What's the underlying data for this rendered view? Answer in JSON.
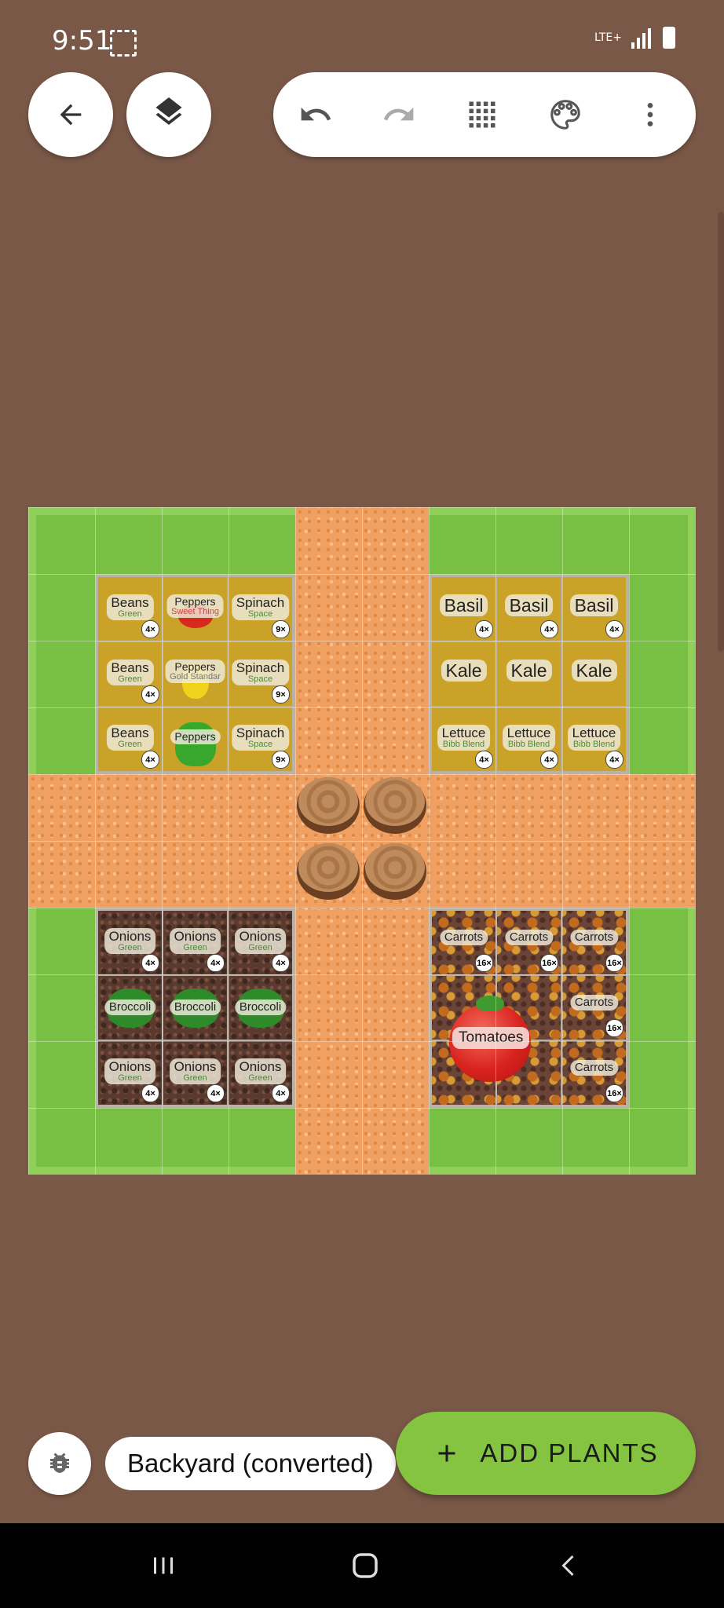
{
  "status_bar": {
    "time": "9:51",
    "network": "LTE+"
  },
  "toolbar": {
    "back_icon": "arrow-left-icon",
    "layers_icon": "layers-icon",
    "undo_icon": "undo-icon",
    "redo_icon": "redo-icon",
    "grid_icon": "grid-icon",
    "palette_icon": "palette-icon",
    "more_icon": "more-vert-icon"
  },
  "beds": {
    "top_left": [
      {
        "name": "Beans",
        "variety": "Green",
        "count": "4×"
      },
      {
        "name": "Peppers",
        "variety": "Sweet Thing",
        "count": ""
      },
      {
        "name": "Spinach",
        "variety": "Space",
        "count": "9×"
      },
      {
        "name": "Beans",
        "variety": "Green",
        "count": "4×"
      },
      {
        "name": "Peppers",
        "variety": "Gold Standar",
        "count": ""
      },
      {
        "name": "Spinach",
        "variety": "Space",
        "count": "9×"
      },
      {
        "name": "Beans",
        "variety": "Green",
        "count": "4×"
      },
      {
        "name": "Peppers",
        "variety": "",
        "count": ""
      },
      {
        "name": "Spinach",
        "variety": "Space",
        "count": "9×"
      }
    ],
    "top_right": [
      {
        "name": "Basil",
        "variety": "",
        "count": "4×"
      },
      {
        "name": "Basil",
        "variety": "",
        "count": "4×"
      },
      {
        "name": "Basil",
        "variety": "",
        "count": "4×"
      },
      {
        "name": "Kale",
        "variety": "",
        "count": ""
      },
      {
        "name": "Kale",
        "variety": "",
        "count": ""
      },
      {
        "name": "Kale",
        "variety": "",
        "count": ""
      },
      {
        "name": "Lettuce",
        "variety": "Bibb Blend",
        "count": "4×"
      },
      {
        "name": "Lettuce",
        "variety": "Bibb Blend",
        "count": "4×"
      },
      {
        "name": "Lettuce",
        "variety": "Bibb Blend",
        "count": "4×"
      }
    ],
    "bottom_left": [
      {
        "name": "Onions",
        "variety": "Green",
        "count": "4×"
      },
      {
        "name": "Onions",
        "variety": "Green",
        "count": "4×"
      },
      {
        "name": "Onions",
        "variety": "Green",
        "count": "4×"
      },
      {
        "name": "Broccoli",
        "variety": "",
        "count": ""
      },
      {
        "name": "Broccoli",
        "variety": "",
        "count": ""
      },
      {
        "name": "Broccoli",
        "variety": "",
        "count": ""
      },
      {
        "name": "Onions",
        "variety": "Green",
        "count": "4×"
      },
      {
        "name": "Onions",
        "variety": "Green",
        "count": "4×"
      },
      {
        "name": "Onions",
        "variety": "Green",
        "count": "4×"
      }
    ],
    "bottom_right": [
      {
        "name": "Carrots",
        "variety": "",
        "count": "16×"
      },
      {
        "name": "Carrots",
        "variety": "",
        "count": "16×"
      },
      {
        "name": "Carrots",
        "variety": "",
        "count": "16×"
      },
      {
        "name": "",
        "variety": "",
        "count": ""
      },
      {
        "name": "",
        "variety": "",
        "count": ""
      },
      {
        "name": "Carrots",
        "variety": "",
        "count": "16×"
      },
      {
        "name": "",
        "variety": "",
        "count": ""
      },
      {
        "name": "",
        "variety": "",
        "count": ""
      },
      {
        "name": "Carrots",
        "variety": "",
        "count": "16×"
      }
    ],
    "tomatoes_label": "Tomatoes"
  },
  "bottom": {
    "debug_icon": "bug-icon",
    "garden_name": "Backyard (converted)",
    "add_plants_label": "ADD PLANTS",
    "add_icon": "plus-icon"
  },
  "nav": {
    "recents_icon": "recents-icon",
    "home_icon": "home-icon",
    "back_icon": "back-chevron-icon"
  }
}
